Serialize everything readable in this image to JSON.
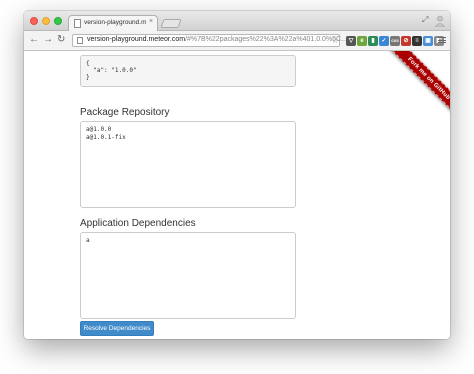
{
  "browser": {
    "tab_title": "version-playground.meteor.com",
    "tab_close": "×",
    "url_host": "version-playground.meteor.com",
    "url_rest": "/#%7B%22packages%22%3A%22a%401.0.0%5C...",
    "extensions": [
      {
        "icon": "pocket-icon",
        "color": "#555555",
        "glyph": "▽"
      },
      {
        "icon": "evernote-icon",
        "color": "#6ea63b",
        "glyph": "e"
      },
      {
        "icon": "hangouts-icon",
        "color": "#2e8b57",
        "glyph": "▮"
      },
      {
        "icon": "blue-ext-icon",
        "color": "#3b87d6",
        "glyph": "✓"
      },
      {
        "icon": "css-icon",
        "color": "#777777",
        "glyph": "css"
      },
      {
        "icon": "red-ext-icon",
        "color": "#c0392b",
        "glyph": "⊘"
      },
      {
        "icon": "buffer-icon",
        "color": "#333333",
        "glyph": "≡"
      },
      {
        "icon": "screenshot-icon",
        "color": "#4a90d9",
        "glyph": "▣"
      },
      {
        "icon": "rss-icon",
        "color": "#8a8a8a",
        "glyph": "◧"
      }
    ]
  },
  "page": {
    "constraints_json": "{\n  \"a\": \"1.0.0\"\n}",
    "package_repository": {
      "label": "Package Repository",
      "value": "a@1.0.0\na@1.0.1-fix"
    },
    "application_dependencies": {
      "label": "Application Dependencies",
      "value": "a"
    },
    "resolve_button": "Resolve Dependencies",
    "ribbon": "Fork me on GitHub"
  }
}
